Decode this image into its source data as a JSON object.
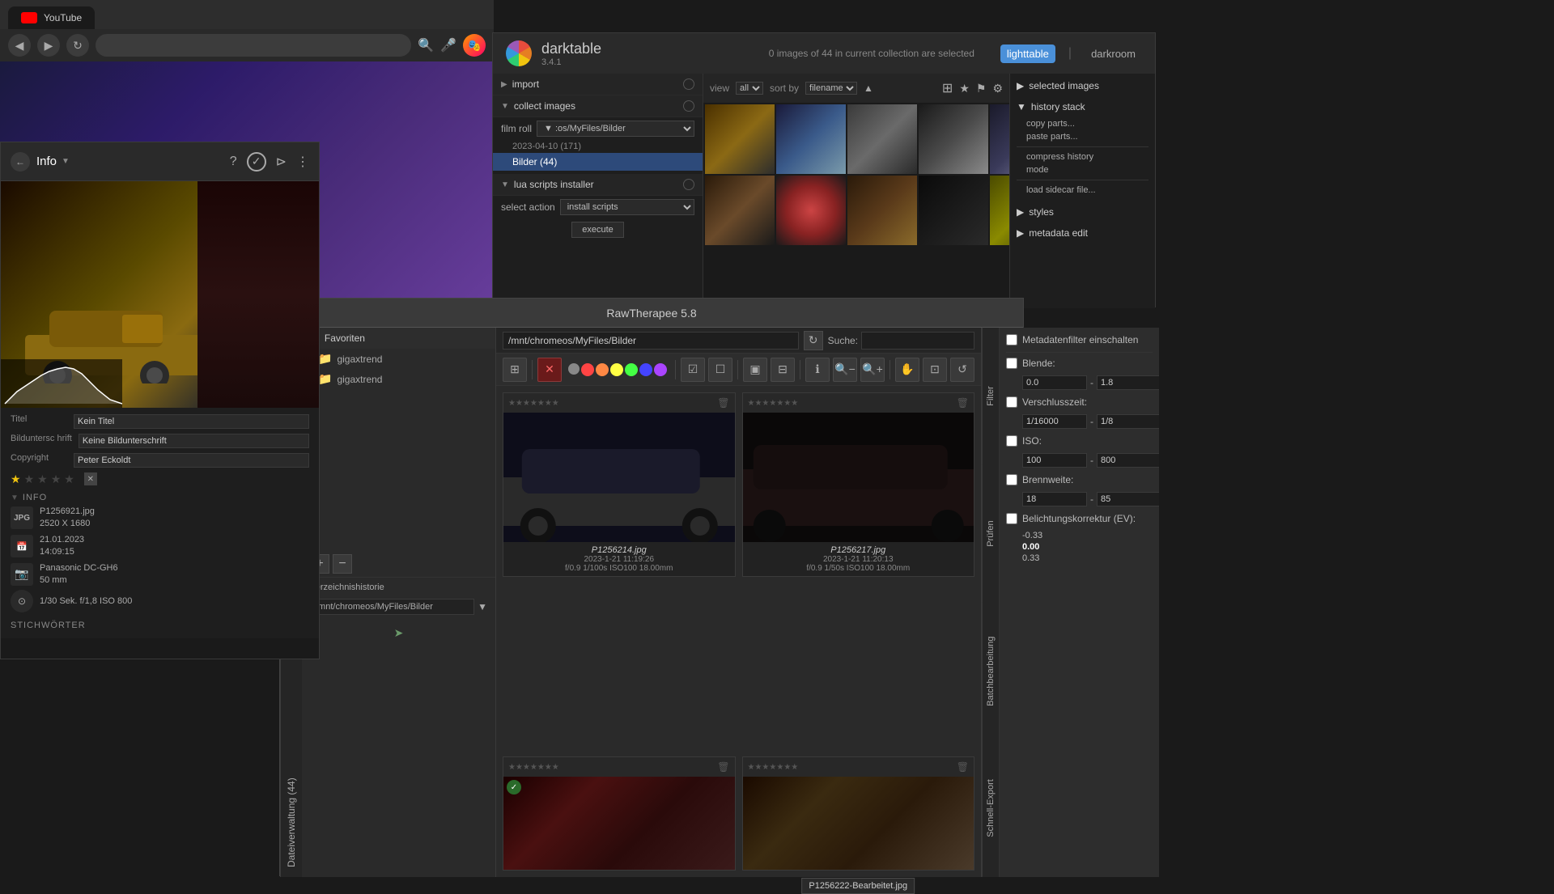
{
  "browser": {
    "title": "YouTube",
    "url": "",
    "back_icon": "◀",
    "forward_icon": "▶",
    "refresh_icon": "↻"
  },
  "darktable": {
    "title": "darktable",
    "version": "3.4.1",
    "collection_info": "0 images of 44 in current collection are selected",
    "nav": {
      "lighttable": "lighttable",
      "separator": "|",
      "darkroom": "darkroom"
    },
    "left_panel": {
      "import_label": "import",
      "collect_label": "collect images",
      "film_roll_label": "film roll",
      "film_path": "▼ :os/MyFiles/Bilder",
      "date": "2023-04-10 (171)",
      "folder": "Bilder (44)",
      "lua_label": "lua scripts installer",
      "select_action": "select action",
      "install_scripts": "install scripts",
      "execute": "execute"
    },
    "toolbar": {
      "view_label": "view",
      "view_value": "all",
      "sort_label": "sort by",
      "sort_value": "filename"
    },
    "right_panel": {
      "selected_images": "selected images",
      "history_stack": "history stack",
      "copy_parts": "copy parts...",
      "paste_parts": "paste parts...",
      "compress_history": "compress history",
      "mode": "mode",
      "load_sidecar": "load sidecar file...",
      "styles": "styles",
      "metadata_edit": "metadata edit"
    }
  },
  "info_panel": {
    "title": "Info",
    "back_arrow": "←",
    "question_icon": "?",
    "check_icon": "✓",
    "share_icon": "⊳",
    "more_icon": "⋮",
    "metadata": {
      "titel_label": "Titel",
      "titel_value": "Kein Titel",
      "bildunterschrift_label": "Bilduntersc hrift",
      "bildunterschrift_value": "Keine Bildunterschrift",
      "copyright_label": "Copyright",
      "copyright_value": "Peter Eckoldt"
    },
    "stars": [
      "★",
      "☆",
      "☆",
      "☆",
      "☆"
    ],
    "info_section": "INFO",
    "file": {
      "type": "JPG",
      "name": "P1256921.jpg",
      "dimensions": "2520 X 1680"
    },
    "date": {
      "value": "21.01.2023",
      "time": "14:09:15"
    },
    "camera": {
      "model": "Panasonic DC-GH6",
      "focal": "50 mm"
    },
    "exposure": {
      "shutter": "1/30 Sek.",
      "aperture": "f/1,8",
      "iso": "ISO 800"
    },
    "keywords_label": "STICHWÖRTER"
  },
  "rawtherapee": {
    "title": "RawTherapee 5.8",
    "path": "/mnt/chromeos/MyFiles/Bilder",
    "search_label": "Suche:",
    "favorites_label": "Favoriten",
    "folders": [
      "gigaxtrend",
      "gigaxtrend"
    ],
    "dir_history_label": "Verzeichnishistorie",
    "dir_path": "/mnt/chromeos/MyFiles/Bilder",
    "sidebar_tab": "Dateiverwaltung (44)",
    "thumbnails": [
      {
        "filename": "P1256214.jpg",
        "date": "2023-1-21 11:19:26",
        "exif": "f/0.9 1/100s ISO100 18.00mm"
      },
      {
        "filename": "P1256217.jpg",
        "date": "2023-1-21 11:20:13",
        "exif": "f/0.9 1/50s ISO100 18.00mm"
      }
    ],
    "tooltip": "P1256222-Bearbeitet.jpg",
    "right_tabs": {
      "filter": "Filter",
      "prufen": "Prüfen",
      "batch": "Batchbearbeitung",
      "export": "Schnell-Export"
    },
    "filter": {
      "metadata_label": "Metadatenfilter einschalten",
      "blende_label": "Blende:",
      "blende_min": "0.0",
      "blende_max": "1.8",
      "verschlusszeit_label": "Verschlusszeit:",
      "verschlusszeit_min": "1/16000",
      "verschlusszeit_max": "1/8",
      "iso_label": "ISO:",
      "iso_min": "100",
      "iso_max": "800",
      "brennweite_label": "Brennweite:",
      "brennweite_min": "18",
      "brennweite_max": "85",
      "belichtung_label": "Belichtungskorrektur (EV):",
      "belichtung_values": [
        "-0.33",
        "0.00",
        "0.33"
      ]
    }
  }
}
